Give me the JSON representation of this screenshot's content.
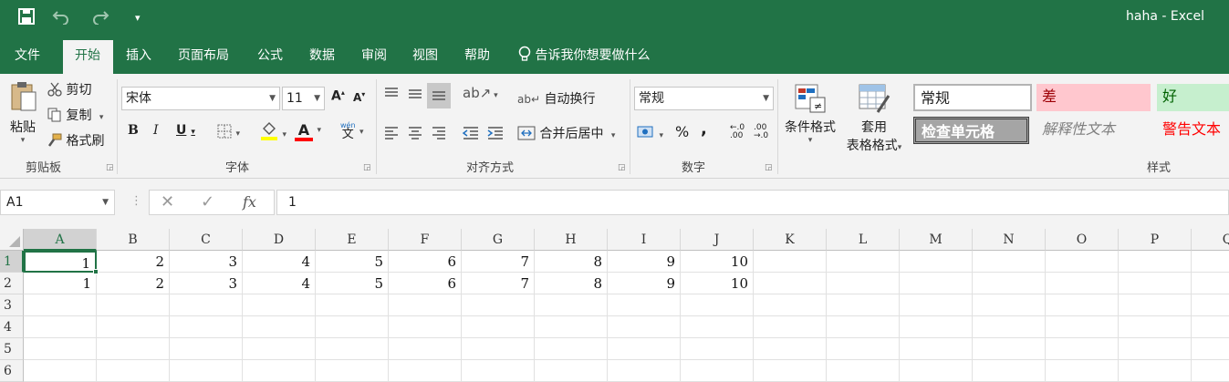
{
  "window": {
    "title": "haha  -  Excel"
  },
  "quick_access": {
    "save_icon": "save-icon",
    "undo_icon": "undo-icon",
    "redo_icon": "redo-icon",
    "customize_icon": "customize-icon"
  },
  "tabs": [
    {
      "label": "文件"
    },
    {
      "label": "开始"
    },
    {
      "label": "插入"
    },
    {
      "label": "页面布局"
    },
    {
      "label": "公式"
    },
    {
      "label": "数据"
    },
    {
      "label": "审阅"
    },
    {
      "label": "视图"
    },
    {
      "label": "帮助"
    }
  ],
  "tell_me": "告诉我你想要做什么",
  "clipboard": {
    "paste": "粘贴",
    "cut": "剪切",
    "copy": "复制",
    "format_painter": "格式刷",
    "group": "剪贴板"
  },
  "font": {
    "name": "宋体",
    "size": "11",
    "group": "字体",
    "bold": "B",
    "italic": "I",
    "underline": "U",
    "grow": "A",
    "shrink": "A",
    "font_color_glyph": "A",
    "phonetic": "文"
  },
  "alignment": {
    "wrap": "自动换行",
    "merge": "合并后居中",
    "group": "对齐方式"
  },
  "number": {
    "format": "常规",
    "percent": "%",
    "comma": ",",
    "group": "数字"
  },
  "styles": {
    "conditional": "条件格式",
    "table_1": "套用",
    "table_2": "表格格式",
    "group": "样式",
    "normal": "常规",
    "bad": "差",
    "good": "好",
    "check": "检查单元格",
    "explanatory": "解释性文本",
    "warning": "警告文本"
  },
  "formula_bar": {
    "name_box": "A1",
    "fx": "fx",
    "content": "1"
  },
  "sheet": {
    "columns": [
      "A",
      "B",
      "C",
      "D",
      "E",
      "F",
      "G",
      "H",
      "I",
      "J",
      "K",
      "L",
      "M",
      "N",
      "O",
      "P",
      "Q"
    ],
    "rows": [
      "1",
      "2",
      "3",
      "4",
      "5",
      "6"
    ],
    "cells": [
      [
        "1",
        "2",
        "3",
        "4",
        "5",
        "6",
        "7",
        "8",
        "9",
        "10"
      ],
      [
        "1",
        "2",
        "3",
        "4",
        "5",
        "6",
        "7",
        "8",
        "9",
        "10"
      ]
    ]
  },
  "colors": {
    "brand": "#217346",
    "bad_bg": "#ffc7ce",
    "bad_fg": "#9c0006",
    "good_bg": "#c6efce",
    "good_fg": "#006100",
    "warning_fg": "#ff0000"
  }
}
